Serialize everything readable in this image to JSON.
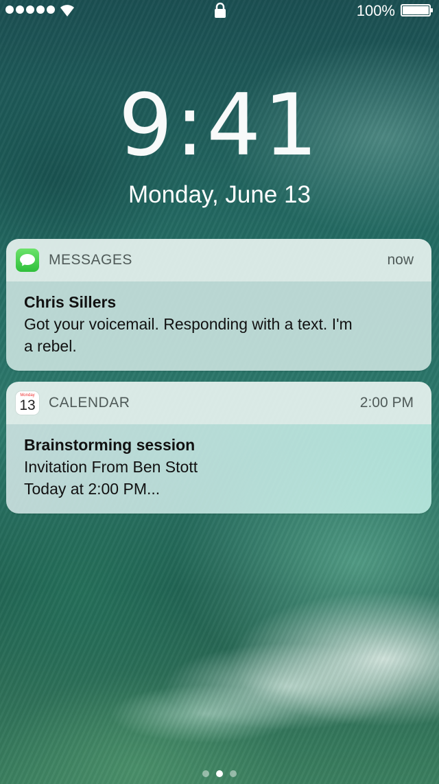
{
  "status_bar": {
    "signal_dots": 5,
    "battery_percent": "100%",
    "icons": [
      "signal-dots-icon",
      "wifi-icon",
      "lock-icon",
      "battery-icon"
    ]
  },
  "lock_screen": {
    "time": "9:41",
    "date": "Monday, June 13"
  },
  "notifications": [
    {
      "app": "MESSAGES",
      "time": "now",
      "icon": "messages-app-icon",
      "title": "Chris Sillers",
      "lines": [
        "Got your voicemail. Responding with a text. I'm",
        "a rebel."
      ]
    },
    {
      "app": "CALENDAR",
      "time": "2:00 PM",
      "icon": "calendar-app-icon",
      "icon_day": "Monday",
      "icon_date": "13",
      "title": "Brainstorming session",
      "lines": [
        "Invitation From Ben Stott",
        "Today at 2:00 PM..."
      ]
    }
  ],
  "page_indicator": {
    "count": 3,
    "active_index": 1
  },
  "colors": {
    "messages_green": "#4cd964",
    "calendar_red": "#ff3b30"
  }
}
